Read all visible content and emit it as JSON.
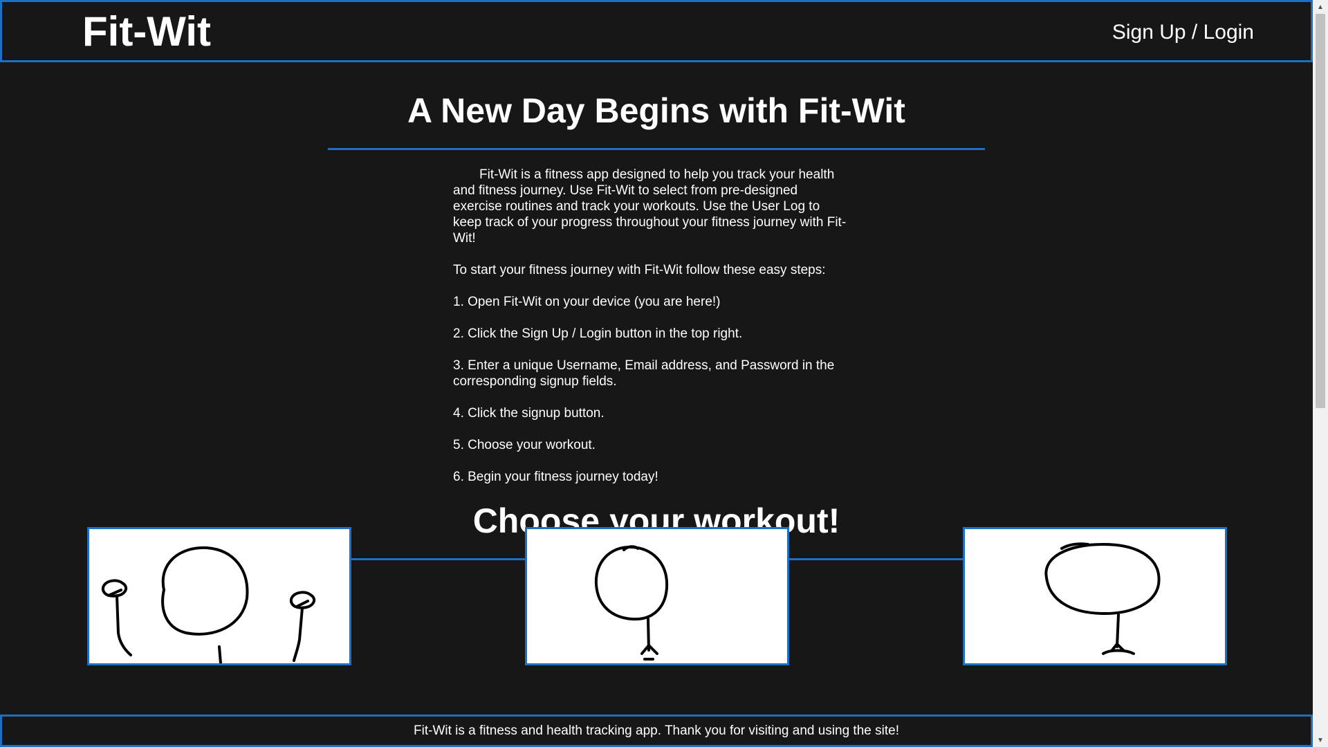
{
  "header": {
    "brand": "Fit-Wit",
    "login_link": "Sign Up / Login"
  },
  "intro_section": {
    "title": "A New Day Begins with Fit-Wit",
    "description": "Fit-Wit is a fitness app designed to help you track your health and fitness journey. Use Fit-Wit to select from pre-designed exercise routines and track your workouts. Use the User Log to keep track of your progress throughout your fitness journey with Fit-Wit!",
    "steps_intro": "To start your fitness journey with Fit-Wit follow these easy steps:",
    "steps": [
      "1. Open Fit-Wit on your device (you are here!)",
      "2. Click the Sign Up / Login button in the top right.",
      "3. Enter a unique Username, Email address, and Password in the corresponding signup fields.",
      "4. Click the signup button.",
      "5. Choose your workout.",
      "6. Begin your fitness journey today!"
    ]
  },
  "workout_section": {
    "title": "Choose your workout!",
    "cards": [
      {
        "icon": "stick-figure-dumbbells-icon"
      },
      {
        "icon": "stick-figure-cardio-icon"
      },
      {
        "icon": "stick-figure-legs-icon"
      }
    ]
  },
  "footer": {
    "text": "Fit-Wit is a fitness and health tracking app. Thank you for visiting and using the site!"
  },
  "colors": {
    "background": "#171718",
    "accent": "#1d6fc4",
    "text": "#ffffff",
    "card_background": "#ffffff"
  }
}
